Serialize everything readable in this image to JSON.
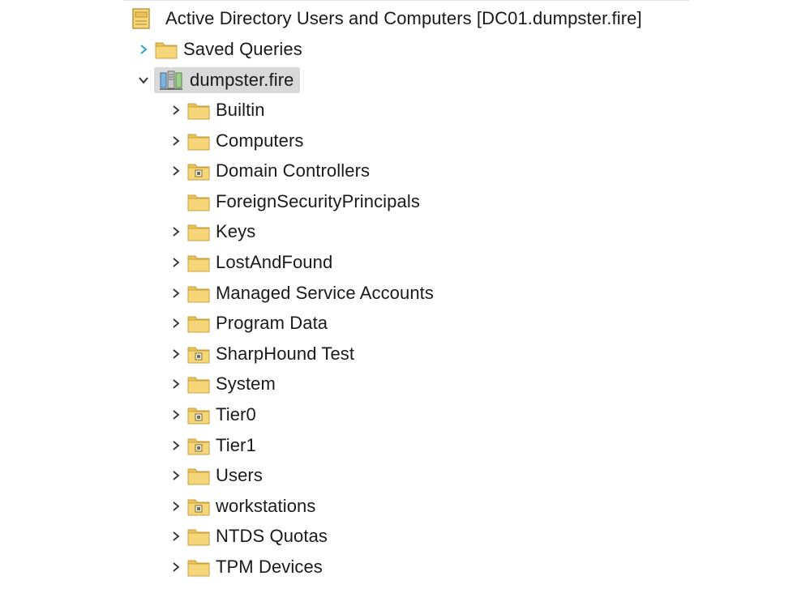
{
  "tree": {
    "root": {
      "label": "Active Directory Users and Computers [DC01.dumpster.fire]",
      "icon": "snapin-root-icon"
    },
    "saved_queries": {
      "label": "Saved Queries",
      "icon": "folder-icon",
      "expanded": false
    },
    "domain": {
      "label": "dumpster.fire",
      "icon": "domain-icon",
      "expanded": true,
      "selected": true
    },
    "children": [
      {
        "label": "Builtin",
        "icon": "folder-icon",
        "expandable": true
      },
      {
        "label": "Computers",
        "icon": "folder-icon",
        "expandable": true
      },
      {
        "label": "Domain Controllers",
        "icon": "ou-icon",
        "expandable": true
      },
      {
        "label": "ForeignSecurityPrincipals",
        "icon": "folder-icon",
        "expandable": false
      },
      {
        "label": "Keys",
        "icon": "folder-icon",
        "expandable": true
      },
      {
        "label": "LostAndFound",
        "icon": "folder-icon",
        "expandable": true
      },
      {
        "label": "Managed Service Accounts",
        "icon": "folder-icon",
        "expandable": true
      },
      {
        "label": "Program Data",
        "icon": "folder-icon",
        "expandable": true
      },
      {
        "label": "SharpHound Test",
        "icon": "ou-icon",
        "expandable": true
      },
      {
        "label": "System",
        "icon": "folder-icon",
        "expandable": true
      },
      {
        "label": "Tier0",
        "icon": "ou-icon",
        "expandable": true
      },
      {
        "label": "Tier1",
        "icon": "ou-icon",
        "expandable": true
      },
      {
        "label": "Users",
        "icon": "folder-icon",
        "expandable": true
      },
      {
        "label": "workstations",
        "icon": "ou-icon",
        "expandable": true
      },
      {
        "label": "NTDS Quotas",
        "icon": "folder-icon",
        "expandable": true
      },
      {
        "label": "TPM Devices",
        "icon": "folder-icon",
        "expandable": true
      }
    ]
  },
  "colors": {
    "folder_body": "#f5d77a",
    "folder_tab": "#e9c25a",
    "folder_edge": "#c9a13c",
    "chevron": "#333333",
    "chevron_accent": "#2b9fd8",
    "selection": "#d9d9d9"
  }
}
